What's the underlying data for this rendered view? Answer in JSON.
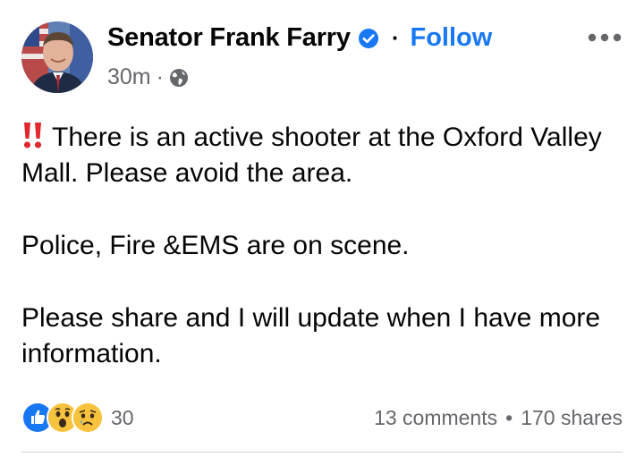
{
  "post": {
    "author": "Senator Frank Farry",
    "follow_label": "Follow",
    "separator": "·",
    "time": "30m",
    "meta_separator": "·",
    "audience_icon": "globe-icon",
    "verified_icon": "verified-badge-icon",
    "more_icon": "more-options-icon",
    "accent_color": "#1877f2",
    "paragraphs": [
      "There is an active shooter at the Oxford Valley Mall. Please avoid the area.",
      "Police, Fire &EMS are on scene.",
      "Please share and I will update when I have more information."
    ],
    "lead_emoji": "double-exclamation-icon"
  },
  "footer": {
    "reaction_icons": [
      "like-reaction-icon",
      "wow-reaction-icon",
      "sad-reaction-icon"
    ],
    "reaction_count": "30",
    "comments": "13 comments",
    "stat_separator": "•",
    "shares": "170 shares"
  }
}
